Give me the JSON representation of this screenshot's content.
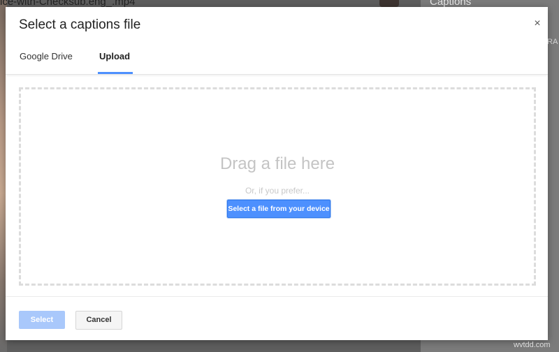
{
  "background": {
    "video_title": "ice-with-Checksub.eng_.mp4",
    "right_panel_heading": "Captions",
    "right_edge_text": "RA"
  },
  "dialog": {
    "title": "Select a captions file",
    "close_icon": "close-icon",
    "close_glyph": "×",
    "tabs": [
      {
        "label": "Google Drive",
        "active": false
      },
      {
        "label": "Upload",
        "active": true
      }
    ],
    "drop_zone": {
      "heading": "Drag a file here",
      "subtext": "Or, if you prefer...",
      "button_label": "Select a file from your device"
    },
    "footer": {
      "select_label": "Select",
      "select_enabled": false,
      "cancel_label": "Cancel"
    }
  },
  "watermark": "wvtdd.com",
  "colors": {
    "accent": "#4d90fe",
    "disabled_accent": "#a9c8fb",
    "overlay": "#5e5e5e"
  }
}
